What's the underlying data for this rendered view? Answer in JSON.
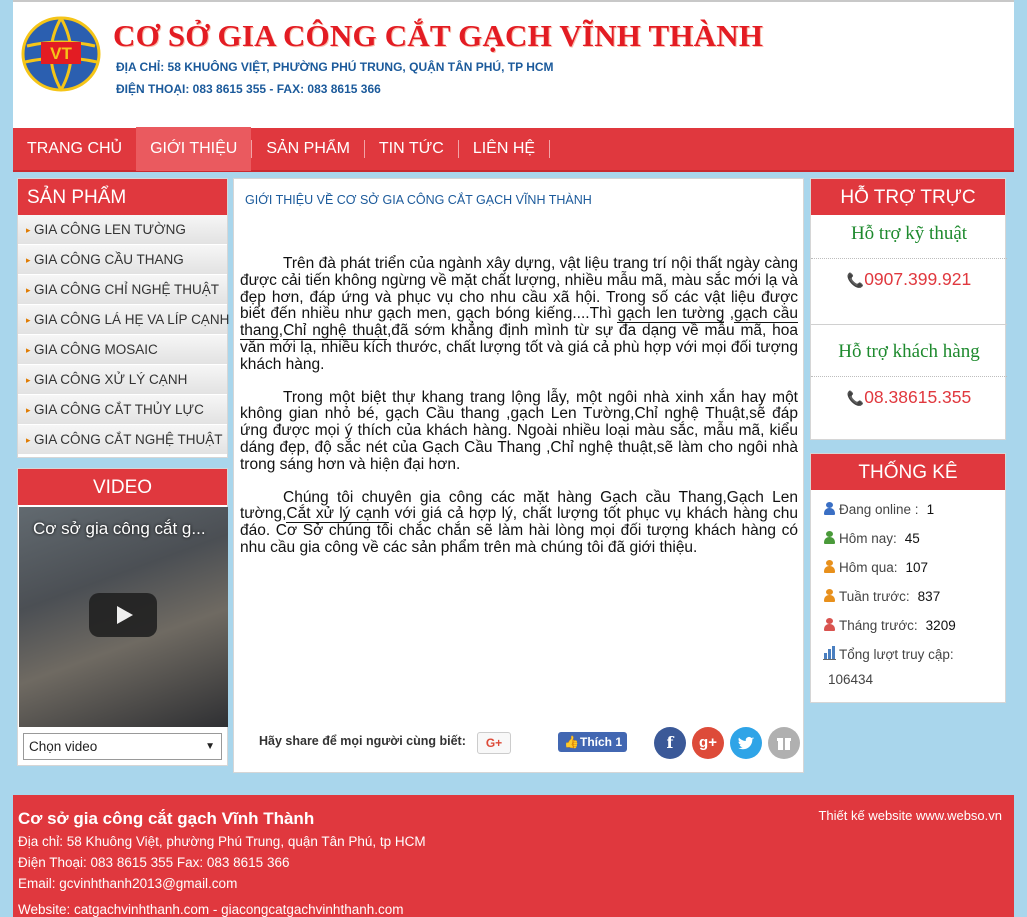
{
  "header": {
    "title": "CƠ SỞ GIA CÔNG CẮT GẠCH VĨNH THÀNH",
    "address": "ĐỊA CHỈ: 58 KHUÔNG VIỆT, PHƯỜNG PHÚ TRUNG, QUẬN TÂN PHÚ, TP HCM",
    "phone": "ĐIỆN THOẠI: 083 8615 355 -   FAX: 083 8615 366",
    "logo_text": "VT"
  },
  "nav": {
    "items": [
      "TRANG CHỦ",
      "GIỚI THIỆU",
      "SẢN PHẨM",
      "TIN TỨC",
      "LIÊN HỆ"
    ],
    "active": "GIỚI THIỆU"
  },
  "products": {
    "heading": "SẢN PHẨM",
    "items": [
      "GIA CÔNG LEN TƯỜNG",
      "GIA CÔNG CẦU THANG",
      "GIA CÔNG CHỈ NGHỆ THUẬT",
      "GIA CÔNG LÁ HẸ VA LÍP CẠNH",
      "GIA CÔNG MOSAIC",
      "GIA CÔNG XỬ LÝ CẠNH",
      "GIA CÔNG CẮT THỦY LỰC",
      "GIA CÔNG CẮT NGHỆ THUẬT"
    ]
  },
  "video": {
    "heading": "VIDEO",
    "title": "Cơ sở gia công cắt g...",
    "select_label": "Chọn video"
  },
  "content": {
    "title": "GIỚI THIỆU VỀ CƠ SỞ GIA CÔNG CẮT GẠCH VĨNH THÀNH",
    "p1_a": "Trên đà phát triển của ngành xây dựng, vật liệu trang trí nội thất ngày càng được cải tiến không ngừng về mặt chất lượng, nhiều mẫu mã, màu sắc mới lạ và đẹp hơn, đáp ứng và phục vụ cho nhu cầu xã hội. Trong số các vật liệu được biết đến nhiều như gạch men, gạch bóng kiếng....Thì ",
    "p1_link1": "gạch len tường",
    "p1_b": " ,",
    "p1_link2": "gạch cầu thang",
    "p1_c": ",",
    "p1_link3": "Chỉ nghệ thuật",
    "p1_d": ",đã sớm khẳng định mình từ sự đa dạng về mẫu mã, hoa văn mới lạ, nhiều kích thước, chất lượng tốt và giá cả phù hợp với mọi đối tượng khách hàng.",
    "p2": " Trong một biệt thự khang trang lộng lẫy, một ngôi nhà xinh xắn hay một không gian nhỏ bé,  gạch Cầu thang ,gạch Len Tường,Chỉ nghệ Thuật,sẽ đáp ứng được mọi ý thích của khách hàng. Ngoài nhiều loại màu sắc, mẫu mã, kiểu dáng đẹp, độ sắc nét của Gạch Cầu Thang ,Chỉ nghệ thuật,sẽ làm cho ngôi nhà trong sáng hơn và hiện đại hơn.",
    "p3_a": "Chúng tôi chuyên gia công các mặt hàng Gạch cầu Thang,Gạch Len tường,",
    "p3_link": "Cắt xử lý cạnh",
    "p3_b": " với giá cả hợp lý, chất lượng tốt phục vụ khách hàng chu đáo. Cơ Sở chúng tôi chắc chắn sẽ làm hài lòng mọi đối tượng khách hàng có nhu cầu gia công về các sản phẩm trên mà chúng tôi đã giới thiệu.",
    "share_label": "Hãy share để mọi người cùng biết:",
    "gplus_label": "G+",
    "fb_like_label": "Thích 1",
    "share_icons": [
      "f",
      "g+",
      "twitter",
      "more"
    ]
  },
  "support": {
    "heading": "HỖ TRỢ TRỰC TUYẾN",
    "tech_title": "Hỗ trợ kỹ thuật",
    "tech_phone": "0907.399.921",
    "customer_title": "Hỗ trợ khách hàng",
    "customer_phone": "08.38615.355"
  },
  "stats": {
    "heading": "THỐNG KÊ",
    "online_label": "Đang online :",
    "online_value": "1",
    "today_label": "Hôm nay:",
    "today_value": "45",
    "yesterday_label": "Hôm qua:",
    "yesterday_value": "107",
    "last_week_label": "Tuần trước:",
    "last_week_value": "837",
    "last_month_label": "Tháng trước:",
    "last_month_value": "3209",
    "total_label": "Tổng lượt truy cập:",
    "total_value": "106434"
  },
  "footer": {
    "name": "Cơ sở gia công cắt gạch Vĩnh Thành",
    "address": "Địa chỉ: 58 Khuông Việt, phường Phú Trung, quận Tân Phú, tp HCM",
    "phone": "Điện Thoại: 083 8615 355   Fax: 083 8615 366",
    "email": "Email: gcvinhthanh2013@gmail.com",
    "website": "Website: catgachvinhthanh.com  - giacongcatgachvinhthanh.com",
    "credit": "Thiết kế website www.webso.vn"
  },
  "colors": {
    "brand_red": "#e0383e",
    "link_blue": "#1b5a9b",
    "support_green": "#1e8a2e",
    "background": "#a9d6ec"
  }
}
